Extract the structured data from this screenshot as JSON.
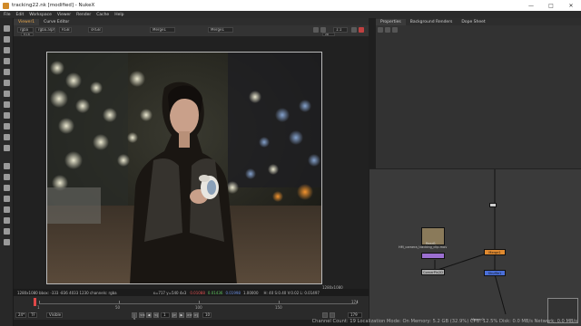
{
  "window": {
    "title": "tracking22.nk [modified] - NukeX"
  },
  "menu": [
    "File",
    "Edit",
    "Workspace",
    "Viewer",
    "Render",
    "Cache",
    "Help"
  ],
  "viewer": {
    "tabs": [
      "Viewer1",
      "Curve Editor"
    ],
    "channels": "rgba",
    "layer": "rgba.alpha",
    "colorspace": "RGB",
    "lut": "sRGB",
    "input_a": "Merge1",
    "input_b": "Merge1",
    "frame_label": "f/1.8",
    "zoom": "1:1",
    "gain_label": "2D",
    "corner_top": "1280,1080",
    "corner_bottom": "1280x1080",
    "format_info": "1280x1080  bbox: -333 -836 4033 1230 channels: rgba",
    "coords": "x=717 y=540 4x3",
    "r": "0.01088",
    "g": "0.01436",
    "b": "0.01998",
    "a": "1.00000",
    "extra": "H: 40 S:0.40 V:0.02 L: 0.01497"
  },
  "timeline": {
    "ticks": [
      "1",
      "50",
      "100",
      "150"
    ],
    "end": "174",
    "end2": "179",
    "frame": "1",
    "fps": "24*",
    "mode": "Visible",
    "playback_mode": "TF",
    "increment": "10"
  },
  "properties": {
    "tabs": [
      "Properties",
      "Background Renders",
      "Dope Sheet"
    ]
  },
  "nodegraph": {
    "read_label": "Read1",
    "read_sub": "HM_camera_tracking_clip.mov",
    "shuffle_label": "Shuffle1",
    "merge_label": "Merge1",
    "viewer_label": "Viewer1",
    "cornerpin_label": "CornerPin2D",
    "left_note": "camera_pin_placeholder"
  },
  "status": "Channel Count: 19 Localization Mode: On Memory: 5.2 GB (32.9%) CPU: 12.5% Disk: 0.0 MB/s Network: 0.0 MB/s",
  "colors": {
    "accent": "#e8a64a",
    "node_orange": "#e08a30",
    "node_blue": "#4a6fd8",
    "node_purple": "#9b6fd0",
    "playhead": "#e04848"
  }
}
